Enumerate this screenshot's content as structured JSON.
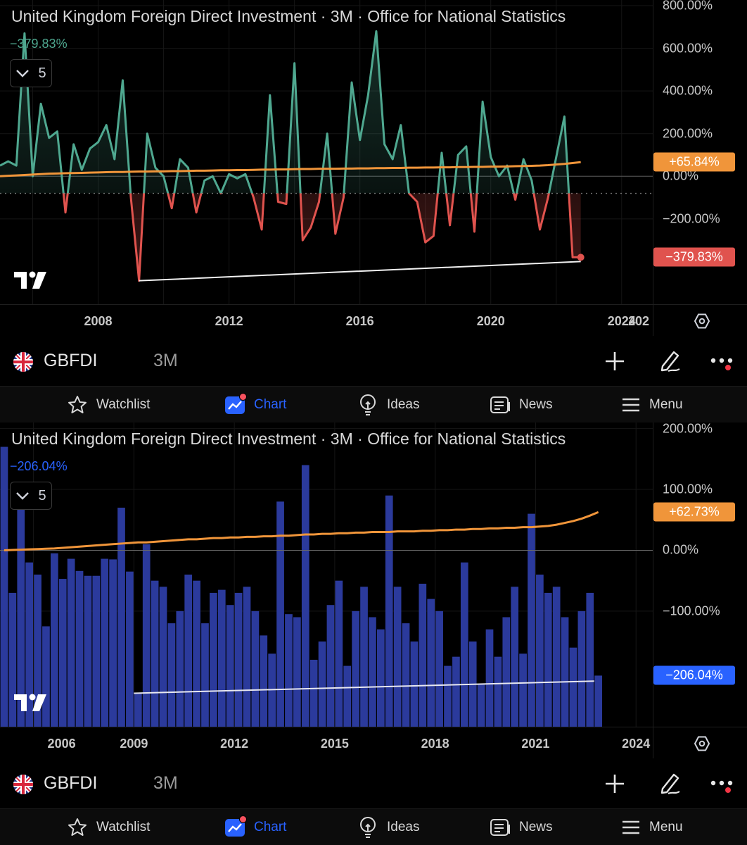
{
  "colors": {
    "line_up": "#4fa890",
    "line_down": "#e0534e",
    "ma": "#f0953a",
    "bar": "#2b3a9c",
    "bar_label": "#2962ff",
    "tag_line": "#f23645",
    "tag_ma": "#f0953a",
    "tag_bar": "#2962ff",
    "active_nav": "#2962ff"
  },
  "panels": [
    {
      "title": "United Kingdom Foreign Direct Investment · 3M · Office for National Statistics",
      "last_value": "−379.83%",
      "collapse_count": "5",
      "y_labels": [
        "800.00%",
        "600.00%",
        "400.00%",
        "200.00%",
        "0.00%",
        "−200.00%"
      ],
      "price_tags": {
        "ma": "+65.84%",
        "last": "−379.83%"
      },
      "x_labels": [
        "2008",
        "2012",
        "2016",
        "2020",
        "2024",
        "202"
      ],
      "symbol": "GBFDI",
      "interval": "3M"
    },
    {
      "title": "United Kingdom Foreign Direct Investment · 3M · Office for National Statistics",
      "last_value": "−206.04%",
      "collapse_count": "5",
      "y_labels": [
        "200.00%",
        "100.00%",
        "0.00%",
        "−100.00%"
      ],
      "price_tags": {
        "ma": "+62.73%",
        "last": "−206.04%"
      },
      "x_labels": [
        "2006",
        "2009",
        "2012",
        "2015",
        "2018",
        "2021",
        "2024"
      ],
      "symbol": "GBFDI",
      "interval": "3M"
    }
  ],
  "nav": [
    {
      "label": "Watchlist",
      "icon": "star-icon",
      "active": false
    },
    {
      "label": "Chart",
      "icon": "chart-icon",
      "active": true
    },
    {
      "label": "Ideas",
      "icon": "lightbulb-icon",
      "active": false
    },
    {
      "label": "News",
      "icon": "news-icon",
      "active": false
    },
    {
      "label": "Menu",
      "icon": "menu-icon",
      "active": false
    }
  ],
  "icons": {
    "flag": "uk-flag-icon",
    "add": "plus-icon",
    "draw": "pen-icon",
    "more": "more-icon",
    "collapse": "chevron-down-icon",
    "settings": "settings-icon",
    "logo": "tradingview-logo"
  },
  "chart_data": [
    {
      "type": "line",
      "title": "United Kingdom Foreign Direct Investment · 3M · Office for National Statistics",
      "x": [
        2005.0,
        2005.25,
        2005.5,
        2005.75,
        2006.0,
        2006.25,
        2006.5,
        2006.75,
        2007.0,
        2007.25,
        2007.5,
        2007.75,
        2008.0,
        2008.25,
        2008.5,
        2008.75,
        2009.0,
        2009.25,
        2009.5,
        2009.75,
        2010.0,
        2010.25,
        2010.5,
        2010.75,
        2011.0,
        2011.25,
        2011.5,
        2011.75,
        2012.0,
        2012.25,
        2012.5,
        2012.75,
        2013.0,
        2013.25,
        2013.5,
        2013.75,
        2014.0,
        2014.25,
        2014.5,
        2014.75,
        2015.0,
        2015.25,
        2015.5,
        2015.75,
        2016.0,
        2016.25,
        2016.5,
        2016.75,
        2017.0,
        2017.25,
        2017.5,
        2017.75,
        2018.0,
        2018.25,
        2018.5,
        2018.75,
        2019.0,
        2019.25,
        2019.5,
        2019.75,
        2020.0,
        2020.25,
        2020.5,
        2020.75,
        2021.0,
        2021.25,
        2021.5,
        2021.75,
        2022.0,
        2022.25,
        2022.5,
        2022.75
      ],
      "series": [
        {
          "values": [
            50,
            70,
            50,
            670,
            0,
            340,
            180,
            210,
            -170,
            150,
            30,
            130,
            160,
            240,
            80,
            450,
            -100,
            -490,
            200,
            40,
            0,
            -150,
            80,
            40,
            -170,
            -20,
            0,
            -80,
            10,
            -10,
            10,
            -100,
            -250,
            380,
            -120,
            -130,
            530,
            -300,
            -240,
            -120,
            200,
            -270,
            -100,
            440,
            170,
            380,
            680,
            150,
            80,
            240,
            -80,
            -120,
            -310,
            -280,
            110,
            -230,
            100,
            140,
            -260,
            350,
            90,
            0,
            50,
            -110,
            80,
            -20,
            -250,
            -100,
            90,
            280,
            -380,
            -380
          ]
        },
        {
          "values": [
            0,
            2,
            4,
            6,
            8,
            10,
            12,
            13,
            14,
            15,
            16,
            17,
            18,
            19,
            20,
            20,
            21,
            22,
            22,
            23,
            23,
            24,
            24,
            25,
            26,
            26,
            27,
            28,
            28,
            29,
            29,
            30,
            31,
            31,
            32,
            32,
            33,
            34,
            34,
            35,
            35,
            35,
            36,
            36,
            37,
            37,
            38,
            38,
            39,
            39,
            40,
            40,
            41,
            41,
            42,
            42,
            43,
            43,
            44,
            44,
            45,
            45,
            46,
            47,
            48,
            49,
            50,
            52,
            55,
            58,
            62,
            66
          ]
        }
      ],
      "ylim": [
        -600,
        800
      ],
      "y_ticks": [
        -200,
        0,
        200,
        400,
        600,
        800
      ],
      "x_ticks": [
        2008,
        2012,
        2016,
        2020,
        2024
      ],
      "grid": true,
      "trendline": {
        "x": [
          2009.25,
          2022.75
        ],
        "y": [
          -490,
          -400
        ]
      },
      "dotted_level": -80
    },
    {
      "type": "bar",
      "title": "United Kingdom Foreign Direct Investment · 3M · Office for National Statistics",
      "x": [
        2005.0,
        2005.25,
        2005.5,
        2005.75,
        2006.0,
        2006.25,
        2006.5,
        2006.75,
        2007.0,
        2007.25,
        2007.5,
        2007.75,
        2008.0,
        2008.25,
        2008.5,
        2008.75,
        2009.0,
        2009.25,
        2009.5,
        2009.75,
        2010.0,
        2010.25,
        2010.5,
        2010.75,
        2011.0,
        2011.25,
        2011.5,
        2011.75,
        2012.0,
        2012.25,
        2012.5,
        2012.75,
        2013.0,
        2013.25,
        2013.5,
        2013.75,
        2014.0,
        2014.25,
        2014.5,
        2014.75,
        2015.0,
        2015.25,
        2015.5,
        2015.75,
        2016.0,
        2016.25,
        2016.5,
        2016.75,
        2017.0,
        2017.25,
        2017.5,
        2017.75,
        2018.0,
        2018.25,
        2018.5,
        2018.75,
        2019.0,
        2019.25,
        2019.5,
        2019.75,
        2020.0,
        2020.25,
        2020.5,
        2020.75,
        2021.0,
        2021.25,
        2021.5,
        2021.75,
        2022.0,
        2022.25,
        2022.5,
        2022.75
      ],
      "series": [
        {
          "values": [
            170,
            -70,
            70,
            -20,
            -40,
            -125,
            -5,
            -47,
            -14,
            -34,
            -42,
            -42,
            -14,
            -15,
            70,
            -35,
            -235,
            10,
            -50,
            -60,
            -120,
            -100,
            -40,
            -50,
            -120,
            -70,
            -65,
            -90,
            -70,
            -60,
            -100,
            -140,
            -170,
            80,
            -105,
            -110,
            140,
            -180,
            -150,
            -90,
            -50,
            -190,
            -100,
            -60,
            -110,
            -130,
            90,
            -60,
            -120,
            -150,
            -55,
            -80,
            -100,
            -190,
            -175,
            -20,
            -150,
            -220,
            -130,
            -175,
            -110,
            -60,
            -170,
            60,
            -40,
            -70,
            -60,
            -110,
            -160,
            -100,
            -70,
            -206
          ]
        },
        {
          "values": [
            0,
            0.5,
            1,
            1.5,
            2,
            2.5,
            3,
            4,
            5,
            6,
            7,
            8,
            9,
            10,
            11,
            12,
            13,
            13,
            14,
            15,
            16,
            17,
            18,
            18,
            19,
            20,
            20,
            21,
            21,
            22,
            22,
            23,
            23,
            24,
            24,
            25,
            26,
            26,
            27,
            27,
            28,
            28,
            29,
            29,
            30,
            30,
            30,
            31,
            31,
            31,
            32,
            32,
            33,
            33,
            34,
            34,
            35,
            35,
            36,
            36,
            37,
            37,
            38,
            38,
            39,
            40,
            42,
            45,
            48,
            52,
            57,
            62.73
          ]
        }
      ],
      "ylim": [
        -290,
        210
      ],
      "y_ticks": [
        -100,
        0,
        100,
        200
      ],
      "x_ticks": [
        2006,
        2009,
        2012,
        2015,
        2018,
        2021,
        2024
      ],
      "grid": true,
      "trendline": {
        "x": [
          2009.0,
          2022.75
        ],
        "y": [
          -235,
          -215
        ]
      }
    }
  ]
}
